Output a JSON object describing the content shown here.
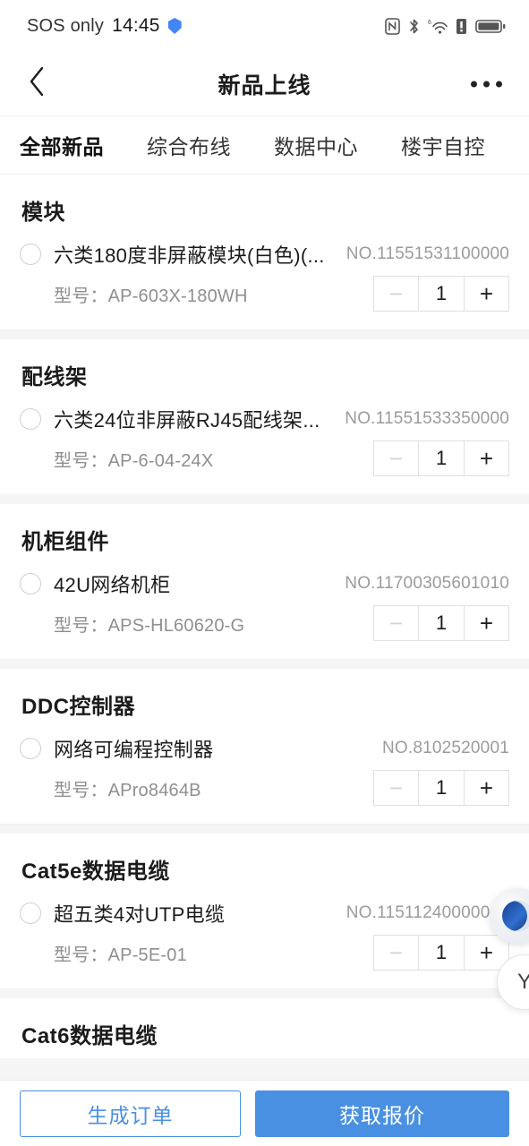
{
  "status_bar": {
    "carrier": "SOS only",
    "time": "14:45",
    "icons": [
      "shield-icon",
      "nfc-icon",
      "bluetooth-icon",
      "wifi6-icon",
      "sim-alert-icon",
      "battery-icon"
    ]
  },
  "header": {
    "back_icon": "chevron-left-icon",
    "title": "新品上线",
    "more_icon": "more-horizontal-icon"
  },
  "tabs": [
    {
      "label": "全部新品",
      "active": true
    },
    {
      "label": "综合布线",
      "active": false
    },
    {
      "label": "数据中心",
      "active": false
    },
    {
      "label": "楼宇自控",
      "active": false
    }
  ],
  "groups": [
    {
      "title": "模块",
      "products": [
        {
          "name": "六类180度非屏蔽模块(白色)(...",
          "no": "NO.11551531100000",
          "model_label": "型号：",
          "model": "AP-603X-180WH",
          "qty": "1",
          "minus": "−",
          "plus": "+"
        }
      ]
    },
    {
      "title": "配线架",
      "products": [
        {
          "name": "六类24位非屏蔽RJ45配线架...",
          "no": "NO.11551533350000",
          "model_label": "型号：",
          "model": "AP-6-04-24X",
          "qty": "1",
          "minus": "−",
          "plus": "+"
        }
      ]
    },
    {
      "title": "机柜组件",
      "products": [
        {
          "name": "42U网络机柜",
          "no": "NO.11700305601010",
          "model_label": "型号：",
          "model": "APS-HL60620-G",
          "qty": "1",
          "minus": "−",
          "plus": "+"
        }
      ]
    },
    {
      "title": "DDC控制器",
      "products": [
        {
          "name": "网络可编程控制器",
          "no": "NO.8102520001",
          "model_label": "型号：",
          "model": "APro8464B",
          "qty": "1",
          "minus": "−",
          "plus": "+"
        }
      ]
    },
    {
      "title": "Cat5e数据电缆",
      "products": [
        {
          "name": "超五类4对UTP电缆",
          "no": "NO.11511240000000",
          "model_label": "型号：",
          "model": "AP-5E-01",
          "qty": "1",
          "minus": "−",
          "plus": "+"
        }
      ]
    },
    {
      "title": "Cat6数据电缆",
      "products": []
    }
  ],
  "floating": {
    "logo_name": "brand-logo-fab",
    "second_glyph": "Y"
  },
  "bottom_bar": {
    "create_order": "生成订单",
    "get_quote": "获取报价"
  },
  "colors": {
    "accent_blue": "#4a90e2",
    "text_primary": "#1b1b1b",
    "text_muted": "#9b9b9b",
    "separator": "#f5f5f5"
  }
}
